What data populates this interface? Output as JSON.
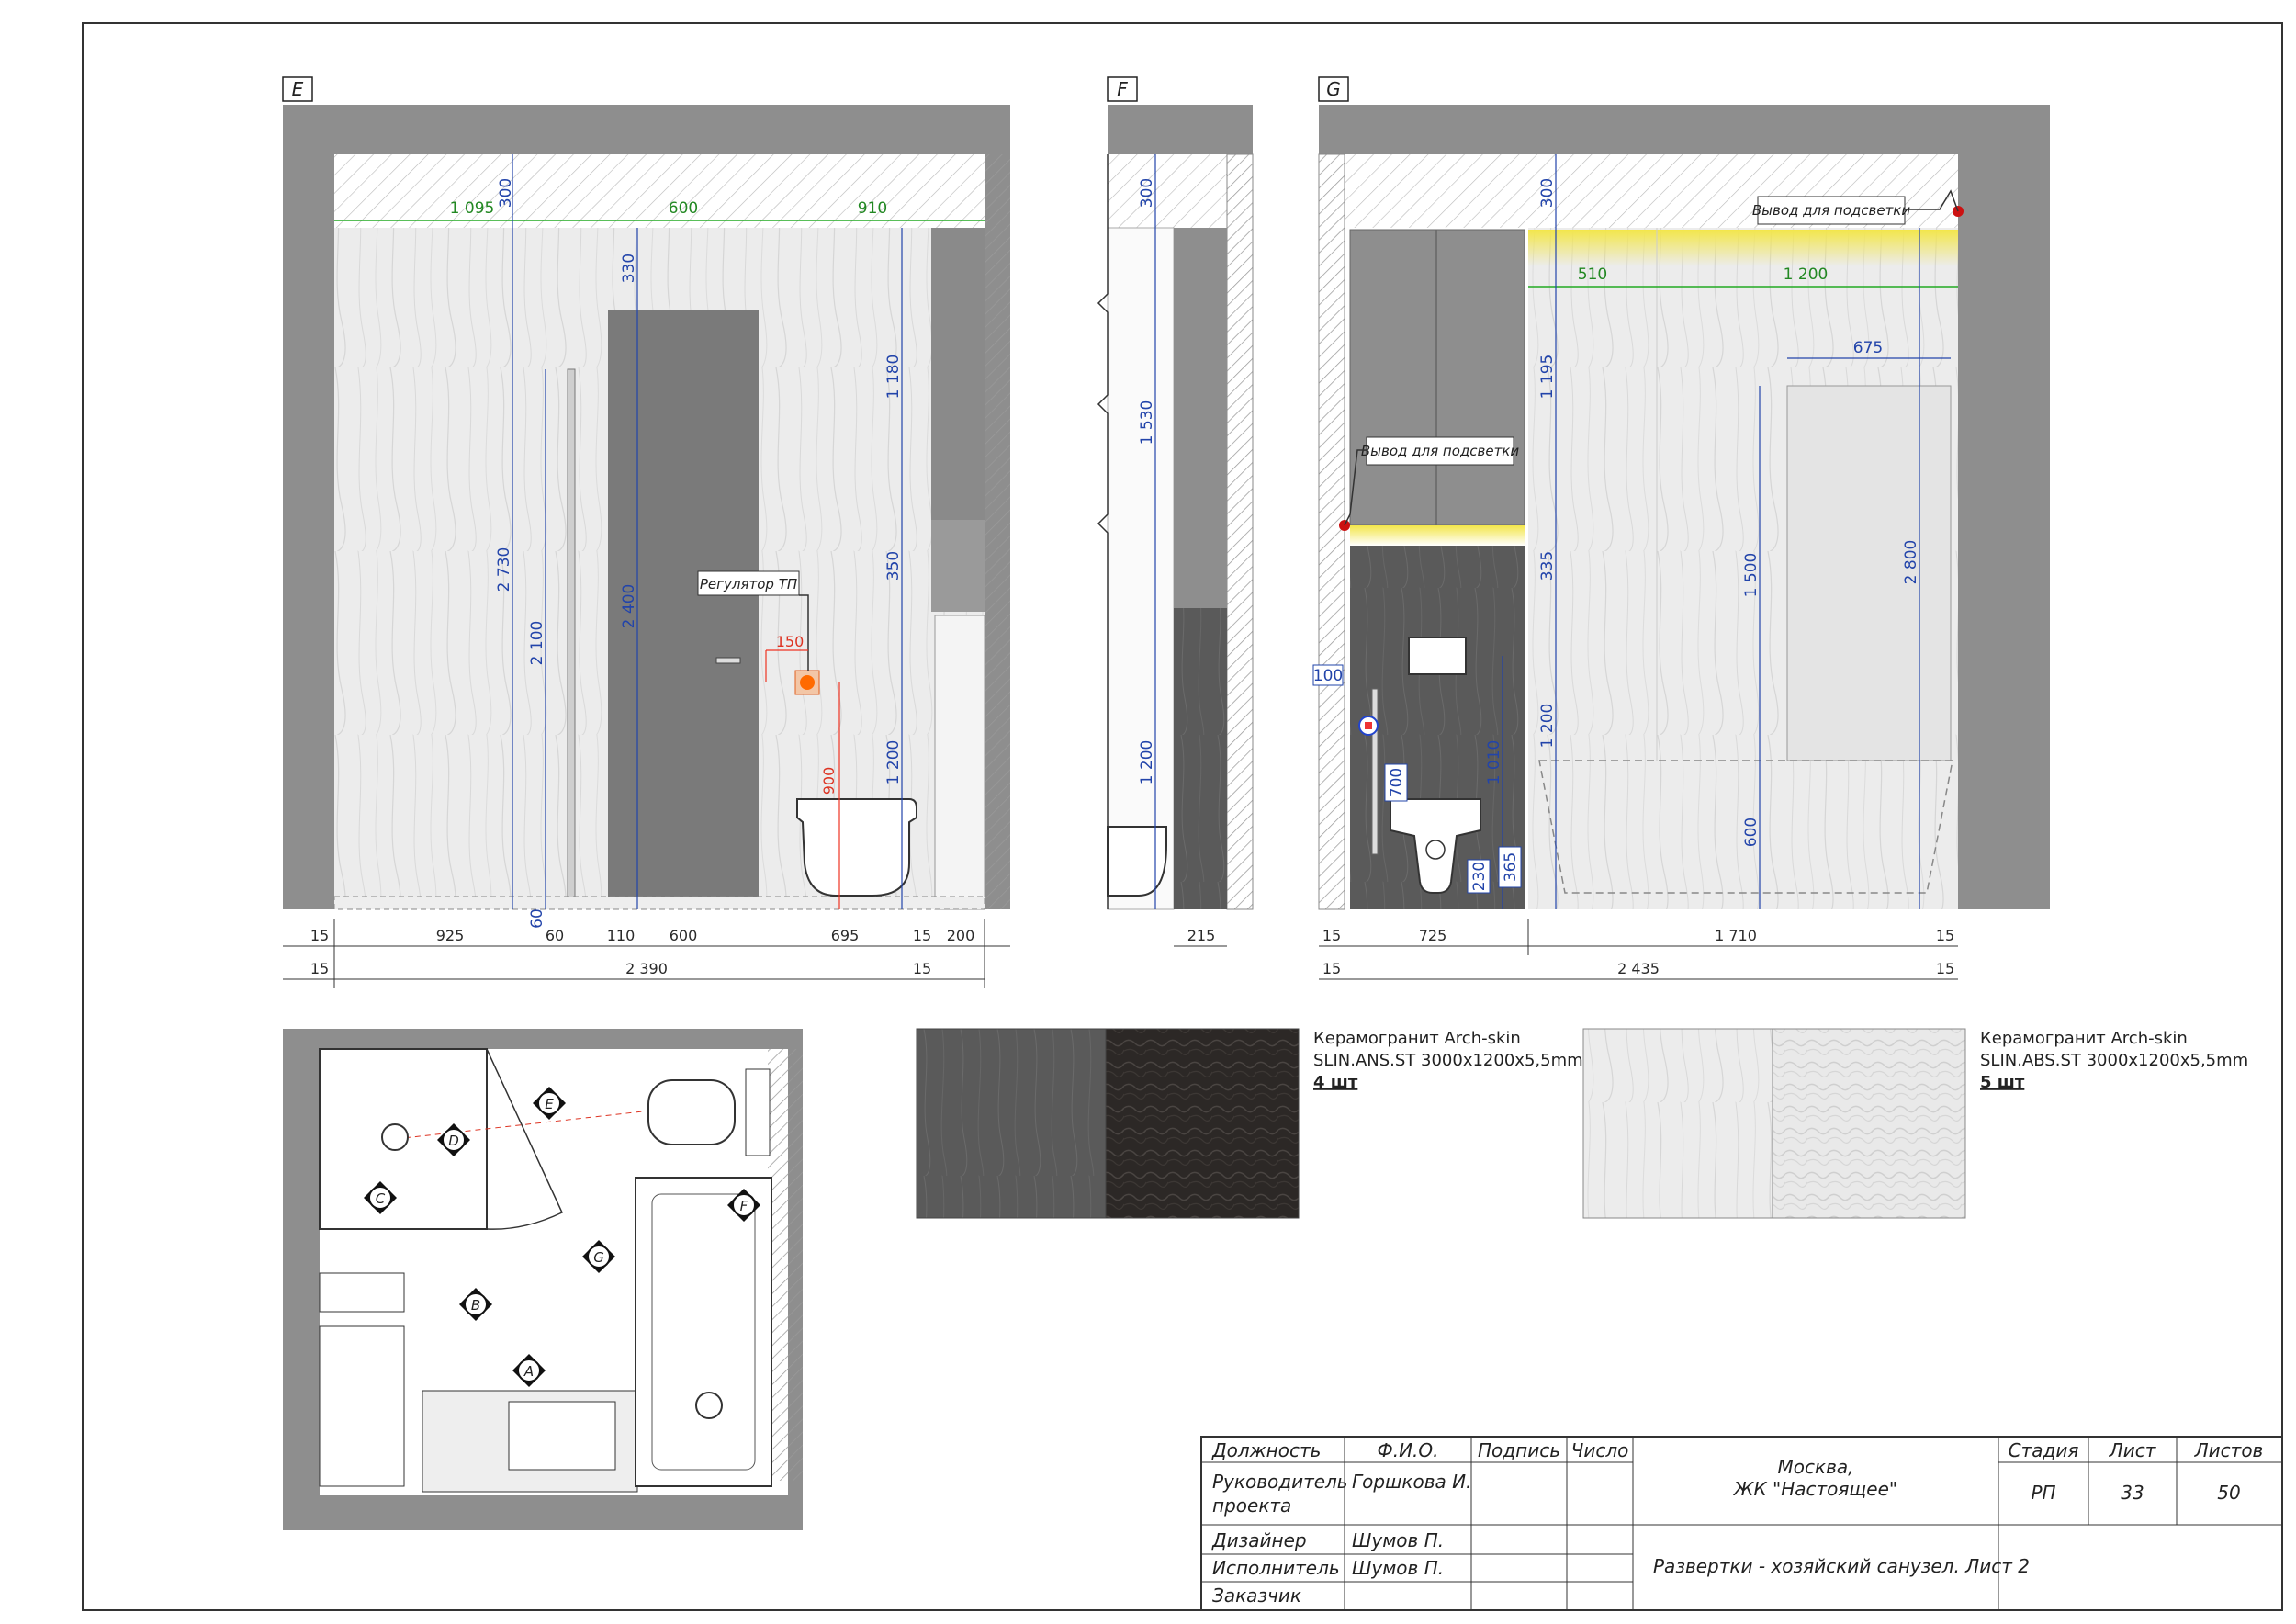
{
  "views": [
    {
      "id": "view-e",
      "label": "E"
    },
    {
      "id": "view-f",
      "label": "F"
    },
    {
      "id": "view-g",
      "label": "G"
    }
  ],
  "callouts": {
    "regulator": "Регулятор ТП",
    "light_outlet_1": "Вывод для подсветки",
    "light_outlet_2": "Вывод для подсветки"
  },
  "dims_e": {
    "top": [
      "1 095",
      "600",
      "910"
    ],
    "vertical": [
      "300",
      "330",
      "1 180",
      "350",
      "1 200",
      "2 730",
      "2 100",
      "2 400",
      "60",
      "150",
      "900"
    ],
    "bottom_row1": [
      "15",
      "925",
      "60",
      "110",
      "600",
      "695",
      "15",
      "200"
    ],
    "bottom_row2": [
      "15",
      "2 390",
      "15"
    ]
  },
  "dims_f": {
    "vertical": [
      "300",
      "1 530",
      "1 200"
    ],
    "bottom": [
      "215"
    ]
  },
  "dims_g": {
    "top": [
      "510",
      "1 200",
      "675"
    ],
    "vertical": [
      "300",
      "1 195",
      "335",
      "1 200",
      "1 500",
      "600",
      "2 800",
      "1 010",
      "700",
      "365",
      "230"
    ],
    "box": "100",
    "bottom_row1": [
      "15",
      "725",
      "1 710",
      "15"
    ],
    "bottom_row2": [
      "15",
      "2 435",
      "15"
    ]
  },
  "plan_markers": [
    "E",
    "D",
    "C",
    "G",
    "F",
    "B",
    "A"
  ],
  "materials": [
    {
      "name": "Керамогранит Arch-skin",
      "code": "SLIN.ANS.ST 3000x1200x5,5mm",
      "qty": "4 шт"
    },
    {
      "name": "Керамогранит Arch-skin",
      "code": "SLIN.ABS.ST 3000x1200x5,5mm",
      "qty": "5 шт"
    }
  ],
  "title_block": {
    "headers": [
      "Должность",
      "Ф.И.О.",
      "Подпись",
      "Число"
    ],
    "rows": [
      {
        "role": "Руководитель",
        "role2": "проекта",
        "name": "Горшкова И."
      },
      {
        "role": "Дизайнер",
        "name": "Шумов П."
      },
      {
        "role": "Исполнитель",
        "name": "Шумов П."
      },
      {
        "role": "Заказчик",
        "name": ""
      }
    ],
    "city": "Москва,",
    "project": "ЖК \"Настоящее\"",
    "sheet_title": "Развертки - хозяйский санузел. Лист 2",
    "stage_label": "Стадия",
    "stage": "РП",
    "sheet_label": "Лист",
    "sheet_no": "33",
    "sheets_label": "Листов",
    "sheets_total": "50"
  },
  "colors": {
    "wall": "#8e8e8e",
    "dark_panel": "#6e6e6e",
    "dim_blue": "#2244aa",
    "dim_green": "#22aa22",
    "dim_red": "#ee3322",
    "led": "#f3e64a"
  }
}
